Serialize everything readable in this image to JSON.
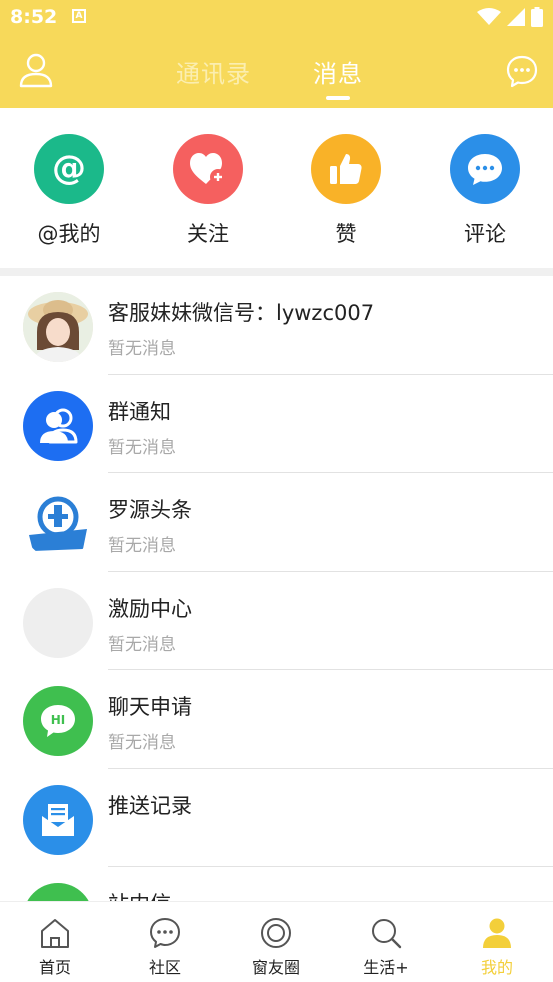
{
  "status_bar": {
    "time": "8:52",
    "a_icon_letter": "A"
  },
  "header": {
    "tabs": [
      {
        "label": "通讯录",
        "active": false
      },
      {
        "label": "消息",
        "active": true
      }
    ],
    "colors": {
      "background": "#f7d95a",
      "active_tab": "#ffffff",
      "inactive_tab": "#fbeeb0"
    }
  },
  "quick_actions": [
    {
      "label": "@我的",
      "icon": "at-icon",
      "color": "#1bb98a"
    },
    {
      "label": "关注",
      "icon": "heart-plus-icon",
      "color": "#f5605f"
    },
    {
      "label": "赞",
      "icon": "thumbs-up-icon",
      "color": "#f9b228"
    },
    {
      "label": "评论",
      "icon": "comment-icon",
      "color": "#2b8fe8"
    }
  ],
  "conversations": [
    {
      "title": "客服妹妹微信号：lywzc007",
      "subtitle": "暂无消息",
      "avatar": "photo-avatar"
    },
    {
      "title": "群通知",
      "subtitle": "暂无消息",
      "avatar": "group-icon",
      "color": "#1d6ef2"
    },
    {
      "title": "罗源头条",
      "subtitle": "暂无消息",
      "avatar": "headline-logo",
      "color": "#2b7fd6"
    },
    {
      "title": "激励中心",
      "subtitle": "暂无消息",
      "avatar": "placeholder-avatar",
      "color": "#eeeeee"
    },
    {
      "title": "聊天申请",
      "subtitle": "暂无消息",
      "avatar": "hi-chat-icon",
      "color": "#3fbf4f",
      "badge_text": "HI"
    },
    {
      "title": "推送记录",
      "subtitle": "",
      "avatar": "mail-icon",
      "color": "#2b8fe8"
    },
    {
      "title": "站内信",
      "subtitle": "",
      "avatar": "green-avatar",
      "color": "#3fbf4f"
    }
  ],
  "bottom_nav": [
    {
      "label": "首页",
      "icon": "home-icon",
      "active": false
    },
    {
      "label": "社区",
      "icon": "community-icon",
      "active": false
    },
    {
      "label": "窗友圈",
      "icon": "circle-icon",
      "active": false
    },
    {
      "label": "生活+",
      "icon": "search-icon",
      "active": false
    },
    {
      "label": "我的",
      "icon": "profile-icon",
      "active": true
    }
  ],
  "accent_color": "#f3cf3a"
}
